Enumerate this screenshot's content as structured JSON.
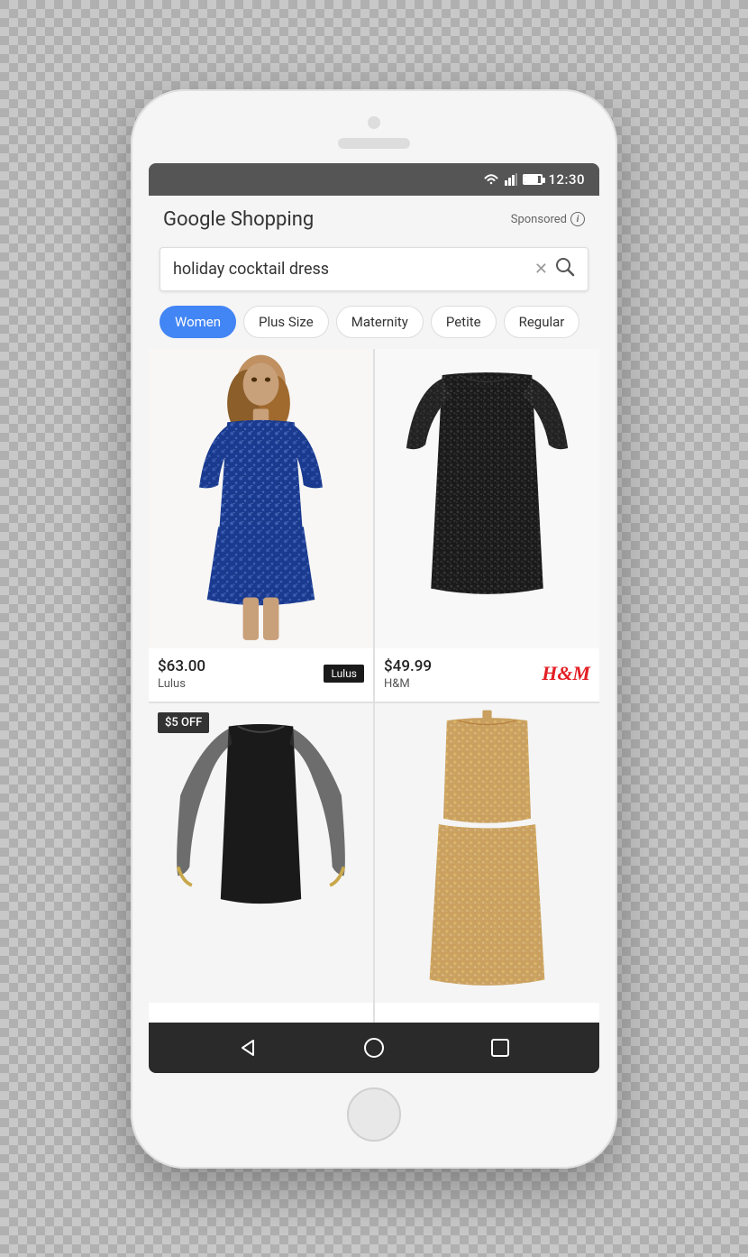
{
  "status_bar": {
    "time": "12:30"
  },
  "header": {
    "app_title": "Google Shopping",
    "sponsored_label": "Sponsored"
  },
  "search": {
    "query": "holiday cocktail dress",
    "clear_label": "×",
    "search_label": "🔍"
  },
  "filters": [
    {
      "id": "women",
      "label": "Women",
      "active": true
    },
    {
      "id": "plus-size",
      "label": "Plus Size",
      "active": false
    },
    {
      "id": "maternity",
      "label": "Maternity",
      "active": false
    },
    {
      "id": "petite",
      "label": "Petite",
      "active": false
    },
    {
      "id": "regular",
      "label": "Regular",
      "active": false
    }
  ],
  "products": [
    {
      "id": "lulus-dress",
      "price": "$63.00",
      "seller": "Lulus",
      "brand": "lulus",
      "discount": null
    },
    {
      "id": "hm-dress",
      "price": "$49.99",
      "seller": "H&M",
      "brand": "hm",
      "discount": null
    },
    {
      "id": "black-dress",
      "price": "",
      "seller": "",
      "brand": "",
      "discount": "$5 OFF"
    },
    {
      "id": "gold-dress",
      "price": "",
      "seller": "",
      "brand": "",
      "discount": null
    }
  ],
  "nav": {
    "back_label": "◁",
    "home_label": "○",
    "recent_label": "□"
  }
}
